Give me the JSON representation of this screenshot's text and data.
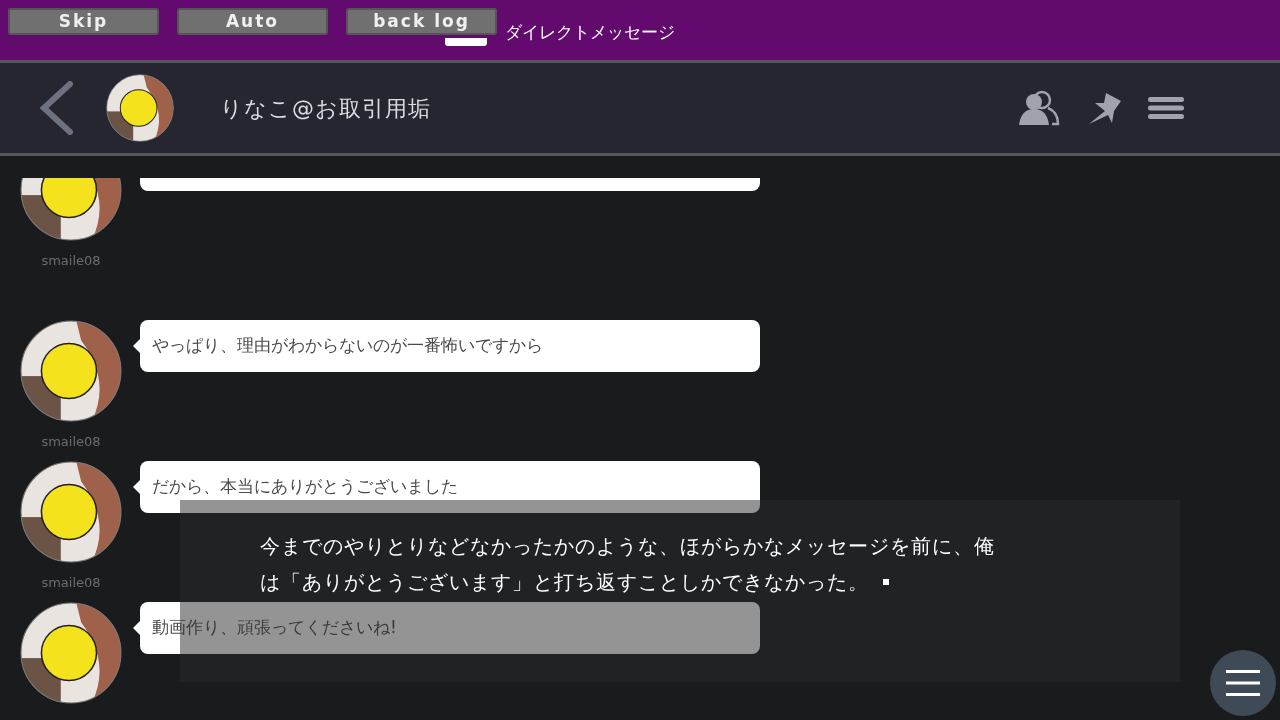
{
  "toolbar": {
    "buttons": [
      "Skip",
      "Auto",
      "back log"
    ],
    "title": "ダイレクトメッセージ"
  },
  "header": {
    "contact_name": "りなこ@お取引用垢"
  },
  "messages": [
    {
      "sender": "smaile08"
    },
    {
      "sender": "smaile08",
      "text": "やっぱり、理由がわからないのが一番怖いですから"
    },
    {
      "sender": "smaile08",
      "text": "だから、本当にありがとうございました"
    },
    {
      "text": "動画作り、頑張ってくださいね!"
    }
  ],
  "narration": {
    "lines": [
      "今までのやりとりなどなかったかのような、ほがらかなメッセージを前に、俺",
      "は「ありがとうございます」と打ち返すことしかできなかった。"
    ]
  }
}
